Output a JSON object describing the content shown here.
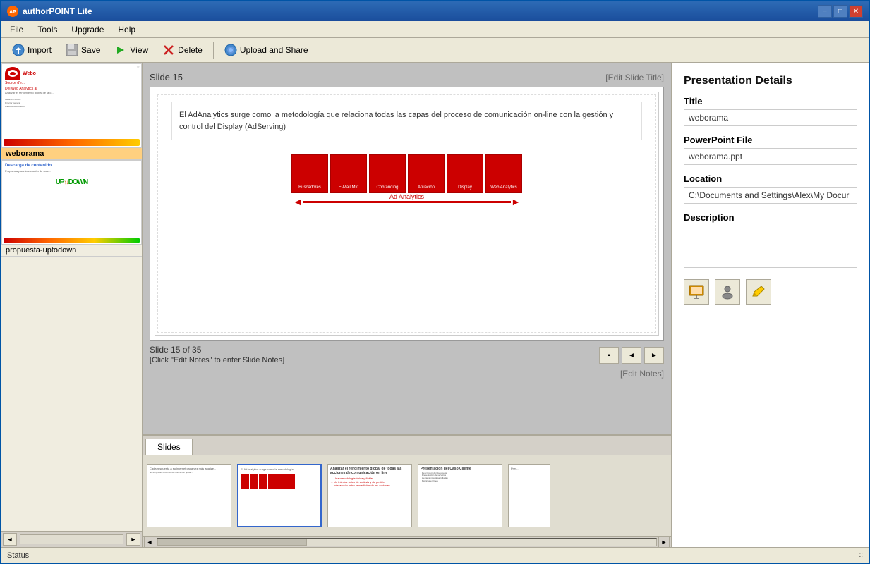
{
  "app": {
    "title": "authorPOINT Lite",
    "icon": "AP"
  },
  "title_controls": {
    "minimize": "−",
    "maximize": "□",
    "close": "✕"
  },
  "menu": {
    "items": [
      "File",
      "Tools",
      "Upgrade",
      "Help"
    ]
  },
  "toolbar": {
    "import_label": "Import",
    "save_label": "Save",
    "view_label": "View",
    "delete_label": "Delete",
    "upload_label": "Upload and Share"
  },
  "slide_view": {
    "title": "Slide 15",
    "edit_title_link": "[Edit Slide Title]",
    "slide_count": "Slide 15 of 35",
    "notes_hint": "[Click \"Edit Notes\" to enter Slide Notes]",
    "edit_notes_link": "[Edit Notes]",
    "slide_text": "El AdAnalytics surge como la metodología que relaciona todas las capas del proceso de comunicación on-line con la gestión y control del Display (AdServing)",
    "boxes": [
      {
        "label": "Buscadores"
      },
      {
        "label": "E-Mail Mkt"
      },
      {
        "label": "Cobranding"
      },
      {
        "label": "Afiliación"
      },
      {
        "label": "Display"
      },
      {
        "label": "Web Analytics"
      }
    ],
    "arrow_label": "Ad Analytics"
  },
  "presentation_details": {
    "heading": "Presentation Details",
    "title_label": "Title",
    "title_value": "weborama",
    "ppt_label": "PowerPoint File",
    "ppt_value": "weborama.ppt",
    "location_label": "Location",
    "location_value": "C:\\Documents and Settings\\Alex\\My Docur",
    "description_label": "Description",
    "description_value": ""
  },
  "sidebar": {
    "items": [
      {
        "label": "weborama",
        "active": true
      },
      {
        "label": "propuesta-uptodown",
        "active": false
      }
    ]
  },
  "bottom_panel": {
    "tab_label": "Slides"
  },
  "status": {
    "text": "Status"
  }
}
